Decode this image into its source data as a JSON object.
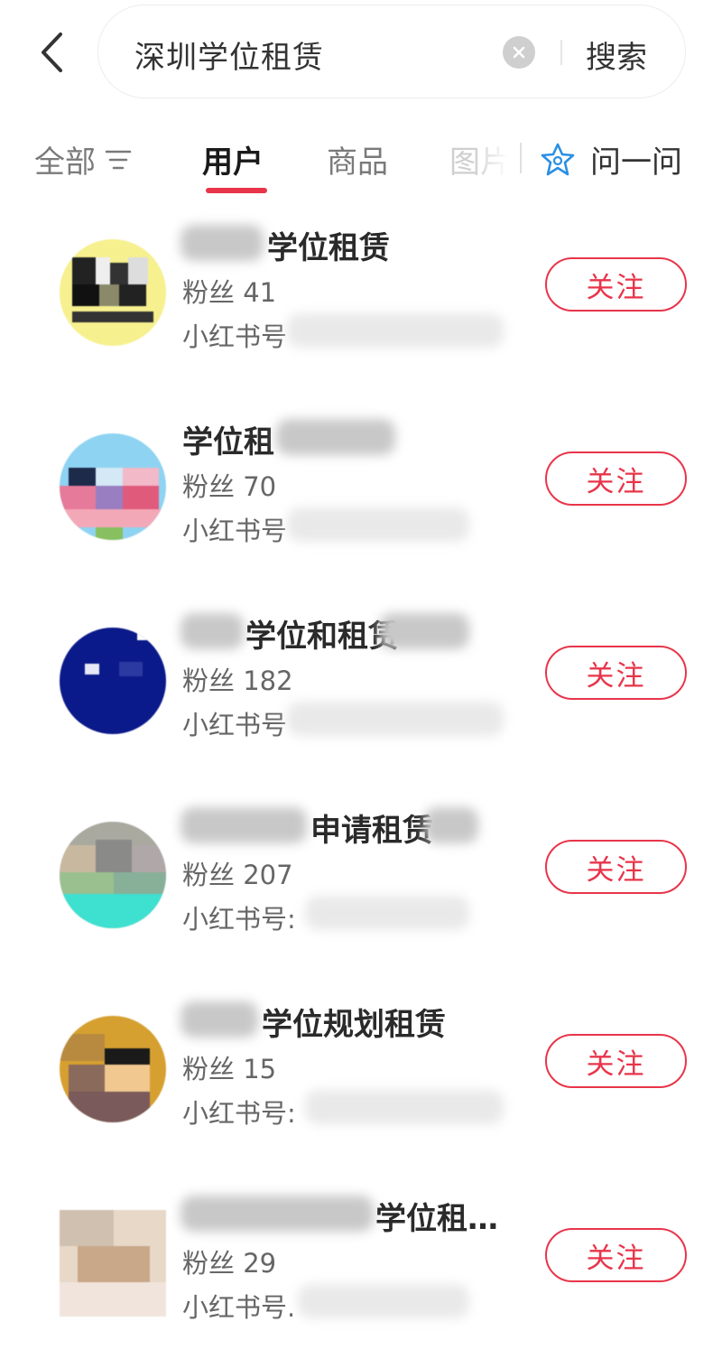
{
  "search": {
    "query": "深圳学位租赁",
    "button_label": "搜索"
  },
  "tabs": {
    "all": "全部",
    "user": "用户",
    "goods": "商品",
    "pictures": "图片",
    "ask": "问一问"
  },
  "icons": {
    "back": "chevron-left-icon",
    "clear": "clear-icon",
    "filter": "filter-icon",
    "ask": "sparkle-star-icon"
  },
  "colors": {
    "accent": "#e8354a",
    "ask_icon": "#2b8fe3"
  },
  "users": [
    {
      "name": "学位租赁",
      "fans": "粉丝 41",
      "id_label": "小红书号",
      "follow": "关注"
    },
    {
      "name": "学位租",
      "fans": "粉丝 70",
      "id_label": "小红书号",
      "follow": "关注"
    },
    {
      "name": "学位和租赁",
      "fans": "粉丝 182",
      "id_label": "小红书号",
      "follow": "关注"
    },
    {
      "name": "申请租赁",
      "fans": "粉丝 207",
      "id_label": "小红书号:",
      "follow": "关注"
    },
    {
      "name": "学位规划租赁",
      "fans": "粉丝 15",
      "id_label": "小红书号:",
      "follow": "关注"
    },
    {
      "name": "学位租…",
      "fans": "粉丝 29",
      "id_label": "小红书号.",
      "follow": "关注"
    }
  ]
}
